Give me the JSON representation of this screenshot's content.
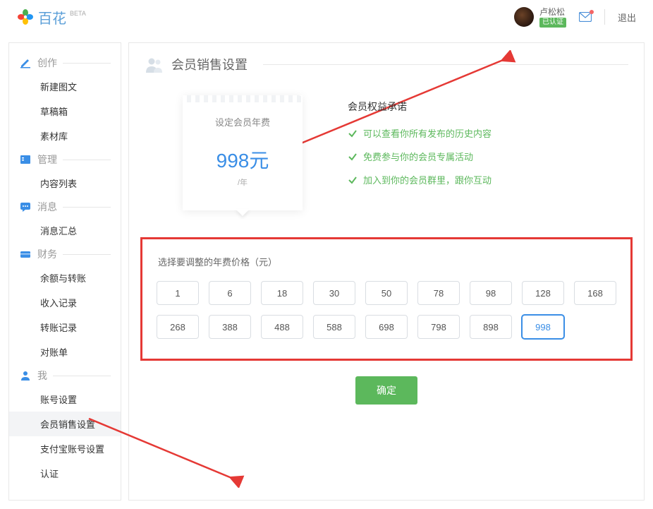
{
  "header": {
    "logo_text": "百花",
    "beta": "BETA",
    "user_name": "卢松松",
    "verified_label": "已认证",
    "logout": "退出"
  },
  "sidebar": {
    "sections": [
      {
        "title": "创作",
        "items": [
          "新建图文",
          "草稿箱",
          "素材库"
        ]
      },
      {
        "title": "管理",
        "items": [
          "内容列表"
        ]
      },
      {
        "title": "消息",
        "items": [
          "消息汇总"
        ]
      },
      {
        "title": "财务",
        "items": [
          "余额与转账",
          "收入记录",
          "转账记录",
          "对账单"
        ]
      },
      {
        "title": "我",
        "items": [
          "账号设置",
          "会员销售设置",
          "支付宝账号设置",
          "认证"
        ]
      }
    ],
    "active_item": "会员销售设置"
  },
  "page": {
    "title": "会员销售设置",
    "price_card": {
      "title": "设定会员年费",
      "price_display": "998元",
      "per": "/年"
    },
    "benefits": {
      "heading": "会员权益承诺",
      "items": [
        "可以查看你所有发布的历史内容",
        "免费参与你的会员专属活动",
        "加入到你的会员群里，跟你互动"
      ]
    },
    "selector": {
      "label": "选择要调整的年费价格（元）",
      "options": [
        "1",
        "6",
        "18",
        "30",
        "50",
        "78",
        "98",
        "128",
        "168",
        "268",
        "388",
        "488",
        "588",
        "698",
        "798",
        "898",
        "998"
      ],
      "selected": "998"
    },
    "confirm": "确定"
  }
}
